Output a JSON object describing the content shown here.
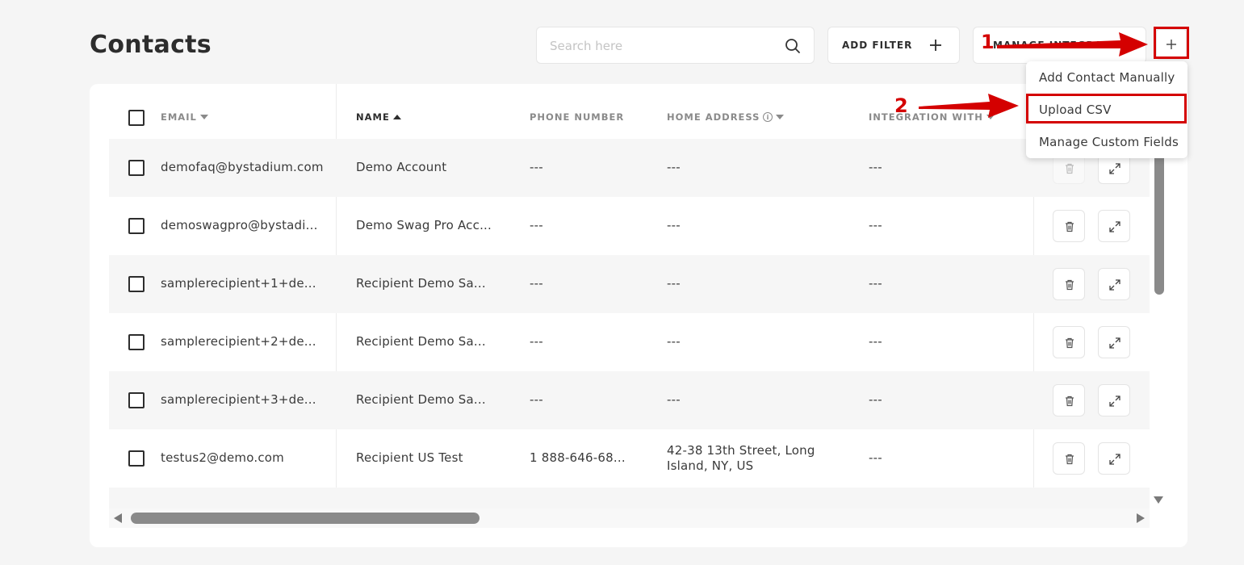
{
  "header": {
    "title": "Contacts",
    "search_placeholder": "Search here",
    "add_filter_label": "ADD FILTER",
    "manage_integrations_label": "MANAGE INTEGRATIONS"
  },
  "table": {
    "columns": {
      "email": "EMAIL",
      "name": "NAME",
      "phone": "PHONE NUMBER",
      "address": "HOME ADDRESS",
      "integration": "INTEGRATION WITH"
    },
    "rows": [
      {
        "email": "demofaq@bystadium.com",
        "name": "Demo Account",
        "phone": "---",
        "address": "---",
        "integration": "---"
      },
      {
        "email": "demoswagpro@bystadi...",
        "name": "Demo Swag Pro Acc...",
        "phone": "---",
        "address": "---",
        "integration": "---"
      },
      {
        "email": "samplerecipient+1+de...",
        "name": "Recipient Demo Sa...",
        "phone": "---",
        "address": "---",
        "integration": "---"
      },
      {
        "email": "samplerecipient+2+de...",
        "name": "Recipient Demo Sa...",
        "phone": "---",
        "address": "---",
        "integration": "---"
      },
      {
        "email": "samplerecipient+3+de...",
        "name": "Recipient Demo Sa...",
        "phone": "---",
        "address": "---",
        "integration": "---"
      },
      {
        "email": "testus2@demo.com",
        "name": "Recipient US Test",
        "phone": "1 888-646-68...",
        "address": " 42-38 13th Street, Long Island, NY, US",
        "integration": "---"
      }
    ]
  },
  "dropdown": {
    "items": [
      "Add Contact Manually",
      "Upload CSV",
      "Manage Custom Fields"
    ]
  },
  "annotations": {
    "step1": "1",
    "step2": "2",
    "color": "#d40000"
  }
}
